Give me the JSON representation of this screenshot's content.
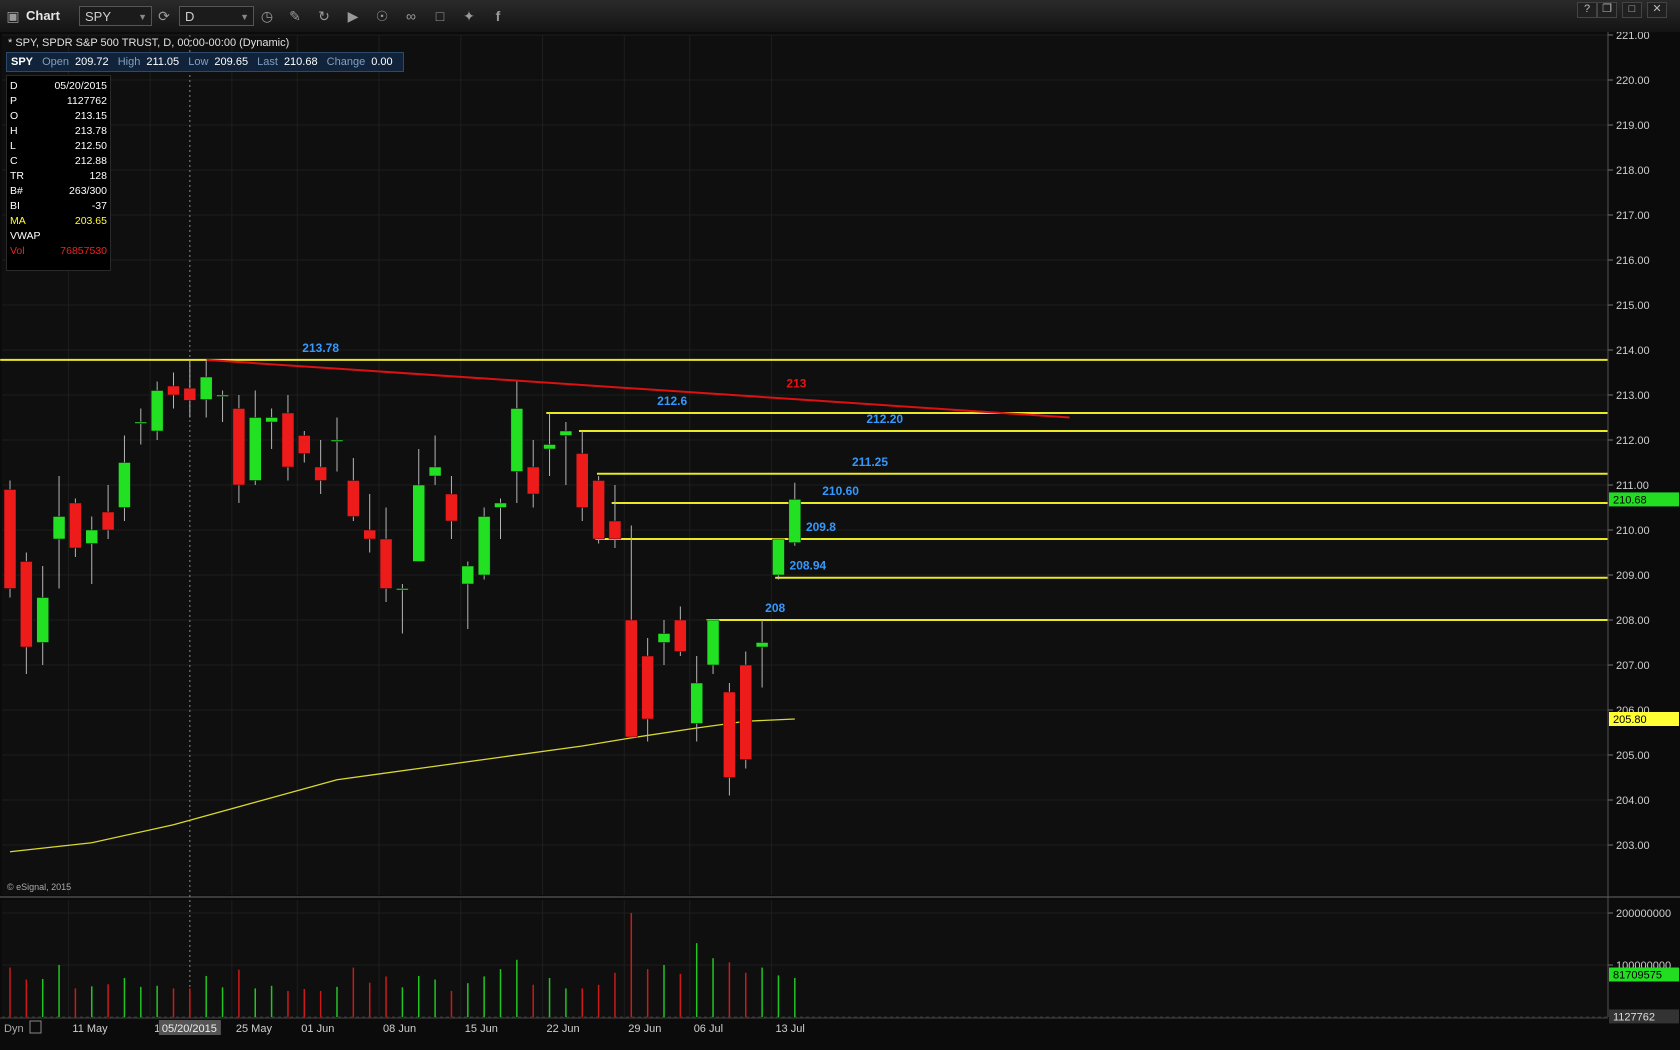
{
  "window": {
    "title": "Chart",
    "symbol_field": "SPY",
    "interval_field": "D",
    "controls": [
      "?",
      "❐",
      "□",
      "✕"
    ]
  },
  "header": {
    "info_line": "* SPY, SPDR S&P 500 TRUST, D, 00:00-00:00 (Dynamic)",
    "quote": {
      "symbol": "SPY",
      "items": [
        {
          "label": "Open",
          "value": "209.72"
        },
        {
          "label": "High",
          "value": "211.05"
        },
        {
          "label": "Low",
          "value": "209.65"
        },
        {
          "label": "Last",
          "value": "210.68"
        },
        {
          "label": "Change",
          "value": "0.00"
        }
      ]
    }
  },
  "data_window": [
    {
      "k": "D",
      "v": "05/20/2015",
      "color": "#ffffff"
    },
    {
      "k": "P",
      "v": "1127762",
      "color": "#ffffff"
    },
    {
      "k": "O",
      "v": "213.15",
      "color": "#ffffff"
    },
    {
      "k": "H",
      "v": "213.78",
      "color": "#ffffff"
    },
    {
      "k": "L",
      "v": "212.50",
      "color": "#ffffff"
    },
    {
      "k": "C",
      "v": "212.88",
      "color": "#ffffff"
    },
    {
      "k": "TR",
      "v": "128",
      "color": "#ffffff"
    },
    {
      "k": "B#",
      "v": "263/300",
      "color": "#ffffff"
    },
    {
      "k": "BI",
      "v": "-37",
      "color": "#ffffff"
    },
    {
      "k": "MA",
      "v": "203.65",
      "color": "#ffff33"
    },
    {
      "k": "VWAP",
      "v": "",
      "color": "#ffffff"
    },
    {
      "k": "Vol",
      "v": "76857530",
      "color": "#ee2222"
    }
  ],
  "footer": {
    "copyright": "© eSignal, 2015",
    "dyn_label": "Dyn",
    "cursor_date": "05/20/2015"
  },
  "chart_data": {
    "type": "candlestick",
    "price_axis": {
      "min": 202.2,
      "max": 221.1,
      "ticks": [
        "221.00",
        "220.00",
        "219.00",
        "218.00",
        "217.00",
        "216.00",
        "215.00",
        "214.00",
        "213.00",
        "212.00",
        "211.00",
        "210.00",
        "209.00",
        "208.00",
        "207.00",
        "206.00",
        "205.00",
        "204.00",
        "203.00"
      ]
    },
    "volume_axis": {
      "max": 225000000,
      "ticks": [
        "200000000",
        "100000000"
      ]
    },
    "date_labels": [
      {
        "i": 4,
        "label": "11 May"
      },
      {
        "i": 9,
        "label": "18 M"
      },
      {
        "i": 14,
        "label": "25 May"
      },
      {
        "i": 18,
        "label": "01 Jun"
      },
      {
        "i": 23,
        "label": "08 Jun"
      },
      {
        "i": 28,
        "label": "15 Jun"
      },
      {
        "i": 33,
        "label": "22 Jun"
      },
      {
        "i": 38,
        "label": "29 Jun"
      },
      {
        "i": 42,
        "label": "06 Jul"
      },
      {
        "i": 47,
        "label": "13 Jul"
      }
    ],
    "cursor_index": 11,
    "candles": [
      {
        "o": 210.9,
        "h": 211.1,
        "l": 208.5,
        "c": 208.7
      },
      {
        "o": 209.3,
        "h": 209.5,
        "l": 206.8,
        "c": 207.4
      },
      {
        "o": 207.5,
        "h": 209.2,
        "l": 207.0,
        "c": 208.5
      },
      {
        "o": 209.8,
        "h": 211.2,
        "l": 208.7,
        "c": 210.3
      },
      {
        "o": 210.6,
        "h": 210.7,
        "l": 209.4,
        "c": 209.6
      },
      {
        "o": 209.7,
        "h": 210.3,
        "l": 208.8,
        "c": 210.0
      },
      {
        "o": 210.4,
        "h": 211.0,
        "l": 209.8,
        "c": 210.0
      },
      {
        "o": 210.5,
        "h": 212.1,
        "l": 210.2,
        "c": 211.5
      },
      {
        "o": 212.4,
        "h": 212.7,
        "l": 211.9,
        "c": 212.4
      },
      {
        "o": 212.2,
        "h": 213.3,
        "l": 212.0,
        "c": 213.1
      },
      {
        "o": 213.2,
        "h": 213.5,
        "l": 212.7,
        "c": 213.0
      },
      {
        "o": 213.15,
        "h": 213.78,
        "l": 212.5,
        "c": 212.88
      },
      {
        "o": 212.9,
        "h": 213.8,
        "l": 212.5,
        "c": 213.4
      },
      {
        "o": 213.0,
        "h": 213.1,
        "l": 212.4,
        "c": 213.0
      },
      {
        "o": 212.7,
        "h": 213.0,
        "l": 210.6,
        "c": 211.0
      },
      {
        "o": 211.1,
        "h": 213.1,
        "l": 211.0,
        "c": 212.5
      },
      {
        "o": 212.4,
        "h": 212.7,
        "l": 211.8,
        "c": 212.5
      },
      {
        "o": 212.6,
        "h": 213.0,
        "l": 211.1,
        "c": 211.4
      },
      {
        "o": 212.1,
        "h": 212.2,
        "l": 211.5,
        "c": 211.7
      },
      {
        "o": 211.4,
        "h": 212.0,
        "l": 210.8,
        "c": 211.1
      },
      {
        "o": 212.0,
        "h": 212.5,
        "l": 211.3,
        "c": 212.0
      },
      {
        "o": 211.1,
        "h": 211.6,
        "l": 210.2,
        "c": 210.3
      },
      {
        "o": 210.0,
        "h": 210.8,
        "l": 209.5,
        "c": 209.8
      },
      {
        "o": 209.8,
        "h": 210.5,
        "l": 208.4,
        "c": 208.7
      },
      {
        "o": 208.7,
        "h": 208.8,
        "l": 207.7,
        "c": 208.7
      },
      {
        "o": 209.3,
        "h": 211.8,
        "l": 209.3,
        "c": 211.0
      },
      {
        "o": 211.2,
        "h": 212.1,
        "l": 211.0,
        "c": 211.4
      },
      {
        "o": 210.8,
        "h": 211.2,
        "l": 209.8,
        "c": 210.2
      },
      {
        "o": 208.8,
        "h": 209.3,
        "l": 207.8,
        "c": 209.2
      },
      {
        "o": 209.0,
        "h": 210.5,
        "l": 208.9,
        "c": 210.3
      },
      {
        "o": 210.5,
        "h": 210.7,
        "l": 209.8,
        "c": 210.6
      },
      {
        "o": 211.3,
        "h": 213.3,
        "l": 210.6,
        "c": 212.7
      },
      {
        "o": 211.4,
        "h": 212.0,
        "l": 210.5,
        "c": 210.8
      },
      {
        "o": 211.8,
        "h": 212.6,
        "l": 211.2,
        "c": 211.9
      },
      {
        "o": 212.1,
        "h": 212.4,
        "l": 211.0,
        "c": 212.2
      },
      {
        "o": 211.7,
        "h": 212.2,
        "l": 210.2,
        "c": 210.5
      },
      {
        "o": 211.1,
        "h": 211.2,
        "l": 209.7,
        "c": 209.8
      },
      {
        "o": 210.2,
        "h": 211.0,
        "l": 209.6,
        "c": 209.8
      },
      {
        "o": 208.0,
        "h": 210.1,
        "l": 205.4,
        "c": 205.4
      },
      {
        "o": 207.2,
        "h": 207.6,
        "l": 205.3,
        "c": 205.8
      },
      {
        "o": 207.5,
        "h": 208.0,
        "l": 207.0,
        "c": 207.7
      },
      {
        "o": 208.0,
        "h": 208.3,
        "l": 207.2,
        "c": 207.3
      },
      {
        "o": 205.7,
        "h": 207.2,
        "l": 205.3,
        "c": 206.6
      },
      {
        "o": 207.0,
        "h": 208.0,
        "l": 206.8,
        "c": 208.0
      },
      {
        "o": 206.4,
        "h": 206.6,
        "l": 204.1,
        "c": 204.5
      },
      {
        "o": 207.0,
        "h": 207.3,
        "l": 204.7,
        "c": 204.9
      },
      {
        "o": 207.4,
        "h": 208.0,
        "l": 206.5,
        "c": 207.5
      },
      {
        "o": 209.0,
        "h": 209.8,
        "l": 208.9,
        "c": 209.8
      },
      {
        "o": 209.72,
        "h": 211.05,
        "l": 209.65,
        "c": 210.68
      }
    ],
    "volumes": [
      95000000,
      72000000,
      73000000,
      100000000,
      55000000,
      59000000,
      63000000,
      75000000,
      58000000,
      60000000,
      55000000,
      55000000,
      79000000,
      57000000,
      91000000,
      55000000,
      60000000,
      50000000,
      54000000,
      50000000,
      58000000,
      95000000,
      66000000,
      78000000,
      57000000,
      79000000,
      72000000,
      50000000,
      65000000,
      78000000,
      92000000,
      110000000,
      62000000,
      75000000,
      55000000,
      55000000,
      62000000,
      85000000,
      200000000,
      92000000,
      100000000,
      83000000,
      142000000,
      113000000,
      105000000,
      85000000,
      95000000,
      80000000,
      75000000
    ],
    "moving_average": [
      {
        "i": 0,
        "v": 202.85
      },
      {
        "i": 5,
        "v": 203.05
      },
      {
        "i": 10,
        "v": 203.45
      },
      {
        "i": 15,
        "v": 203.95
      },
      {
        "i": 20,
        "v": 204.45
      },
      {
        "i": 25,
        "v": 204.7
      },
      {
        "i": 30,
        "v": 204.95
      },
      {
        "i": 35,
        "v": 205.2
      },
      {
        "i": 38,
        "v": 205.38
      },
      {
        "i": 42,
        "v": 205.6
      },
      {
        "i": 45,
        "v": 205.75
      },
      {
        "i": 48,
        "v": 205.8
      }
    ],
    "horizontal_levels": [
      {
        "value": 213.78,
        "label": "213.78",
        "start_i": -0.6,
        "label_i": 19
      },
      {
        "value": 212.6,
        "label": "212.6",
        "start_i": 32.8,
        "label_i": 40.5
      },
      {
        "value": 212.2,
        "label": "212.20",
        "start_i": 34.8,
        "label_i": 53.5
      },
      {
        "value": 211.25,
        "label": "211.25",
        "start_i": 35.9,
        "label_i": 52.6
      },
      {
        "value": 210.6,
        "label": "210.60",
        "start_i": 36.8,
        "label_i": 50.8
      },
      {
        "value": 209.8,
        "label": "209.8",
        "start_i": 35.8,
        "label_i": 49.6
      },
      {
        "value": 208.94,
        "label": "208.94",
        "start_i": 46.8,
        "label_i": 48.8
      },
      {
        "value": 208.0,
        "label": "208",
        "start_i": 42.6,
        "label_i": 46.8
      }
    ],
    "trendline": {
      "from_i": 12,
      "from_v": 213.78,
      "to_i": 64.8,
      "to_v": 212.5,
      "label": "213",
      "label_i": 48.1,
      "label_v": 213.08
    },
    "price_markers": [
      {
        "value": 210.68,
        "label": "210.68",
        "color": "#22dd22"
      },
      {
        "value": 205.8,
        "label": "205.80",
        "color": "#ffff33"
      }
    ],
    "volume_markers": [
      {
        "value": 81709575,
        "label": "81709575",
        "color": "#22dd22"
      },
      {
        "value": 1127762,
        "label": "1127762",
        "color": "#333333"
      }
    ]
  }
}
